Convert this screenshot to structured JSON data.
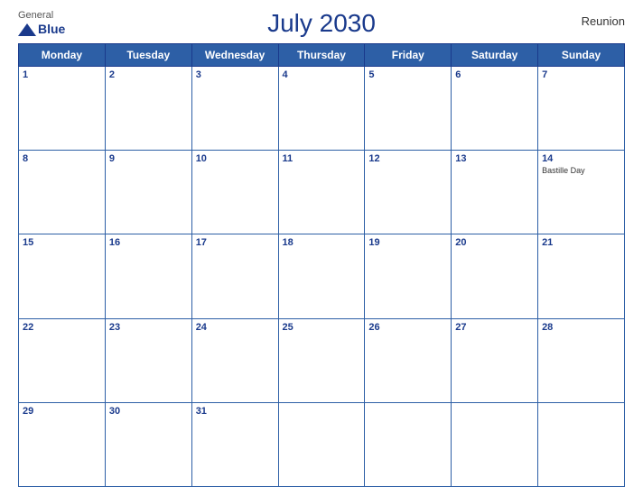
{
  "header": {
    "title": "July 2030",
    "region": "Reunion",
    "logo": {
      "line1": "General",
      "line2": "Blue"
    }
  },
  "days_of_week": [
    "Monday",
    "Tuesday",
    "Wednesday",
    "Thursday",
    "Friday",
    "Saturday",
    "Sunday"
  ],
  "weeks": [
    [
      {
        "day": 1,
        "events": []
      },
      {
        "day": 2,
        "events": []
      },
      {
        "day": 3,
        "events": []
      },
      {
        "day": 4,
        "events": []
      },
      {
        "day": 5,
        "events": []
      },
      {
        "day": 6,
        "events": []
      },
      {
        "day": 7,
        "events": []
      }
    ],
    [
      {
        "day": 8,
        "events": []
      },
      {
        "day": 9,
        "events": []
      },
      {
        "day": 10,
        "events": []
      },
      {
        "day": 11,
        "events": []
      },
      {
        "day": 12,
        "events": []
      },
      {
        "day": 13,
        "events": []
      },
      {
        "day": 14,
        "events": [
          "Bastille Day"
        ]
      }
    ],
    [
      {
        "day": 15,
        "events": []
      },
      {
        "day": 16,
        "events": []
      },
      {
        "day": 17,
        "events": []
      },
      {
        "day": 18,
        "events": []
      },
      {
        "day": 19,
        "events": []
      },
      {
        "day": 20,
        "events": []
      },
      {
        "day": 21,
        "events": []
      }
    ],
    [
      {
        "day": 22,
        "events": []
      },
      {
        "day": 23,
        "events": []
      },
      {
        "day": 24,
        "events": []
      },
      {
        "day": 25,
        "events": []
      },
      {
        "day": 26,
        "events": []
      },
      {
        "day": 27,
        "events": []
      },
      {
        "day": 28,
        "events": []
      }
    ],
    [
      {
        "day": 29,
        "events": []
      },
      {
        "day": 30,
        "events": []
      },
      {
        "day": 31,
        "events": []
      },
      {
        "day": null,
        "events": []
      },
      {
        "day": null,
        "events": []
      },
      {
        "day": null,
        "events": []
      },
      {
        "day": null,
        "events": []
      }
    ]
  ]
}
